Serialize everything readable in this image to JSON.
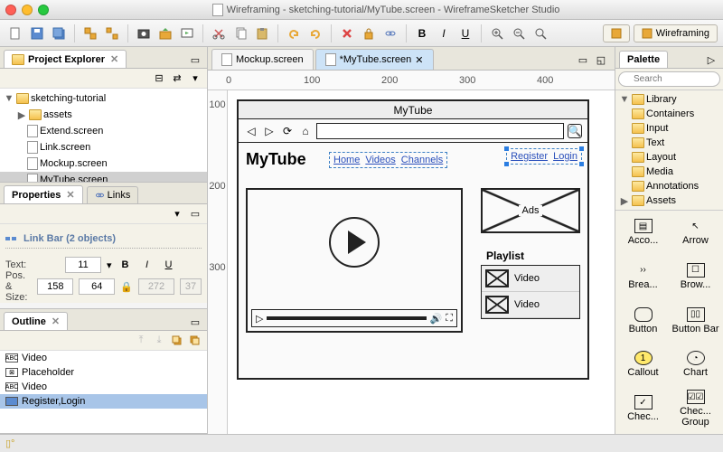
{
  "titlebar": {
    "title": "Wireframing - sketching-tutorial/MyTube.screen - WireframeSketcher Studio"
  },
  "perspective": {
    "label": "Wireframing"
  },
  "project_explorer": {
    "title": "Project Explorer",
    "root": "sketching-tutorial",
    "items": [
      "assets",
      "Extend.screen",
      "Link.screen",
      "Mockup.screen",
      "MyTube.screen"
    ]
  },
  "properties": {
    "title": "Properties",
    "links_tab": "Links",
    "header": "Link Bar (2 objects)",
    "text_label": "Text:",
    "font_size": "11",
    "pos_label": "Pos. & Size:",
    "x": "158",
    "y": "64",
    "w": "272",
    "h": "37"
  },
  "outline": {
    "title": "Outline",
    "items": [
      {
        "label": "Video",
        "type": "abc"
      },
      {
        "label": "Placeholder",
        "type": "ph"
      },
      {
        "label": "Video",
        "type": "abc"
      },
      {
        "label": "Register,Login",
        "type": "link",
        "sel": true
      }
    ]
  },
  "editor": {
    "tabs": [
      "Mockup.screen",
      "*MyTube.screen"
    ],
    "active": 1,
    "ruler_h": [
      "0",
      "100",
      "200",
      "300",
      "400"
    ],
    "ruler_v": [
      "100",
      "200",
      "300"
    ]
  },
  "wireframe": {
    "window_title": "MyTube",
    "heading": "MyTube",
    "nav": [
      "Home",
      "Videos",
      "Channels"
    ],
    "auth": [
      "Register",
      "Login"
    ],
    "ads": "Ads",
    "playlist_label": "Playlist",
    "playlist": [
      "Video",
      "Video"
    ]
  },
  "palette": {
    "title": "Palette",
    "search_placeholder": "Search",
    "library": "Library",
    "categories": [
      "Containers",
      "Input",
      "Text",
      "Layout",
      "Media",
      "Annotations"
    ],
    "assets": "Assets",
    "items": [
      "Acco...",
      "Arrow",
      "Brea...",
      "Brow...",
      "Button",
      "Button Bar",
      "Callout",
      "Chart",
      "Chec...",
      "Chec... Group"
    ]
  }
}
